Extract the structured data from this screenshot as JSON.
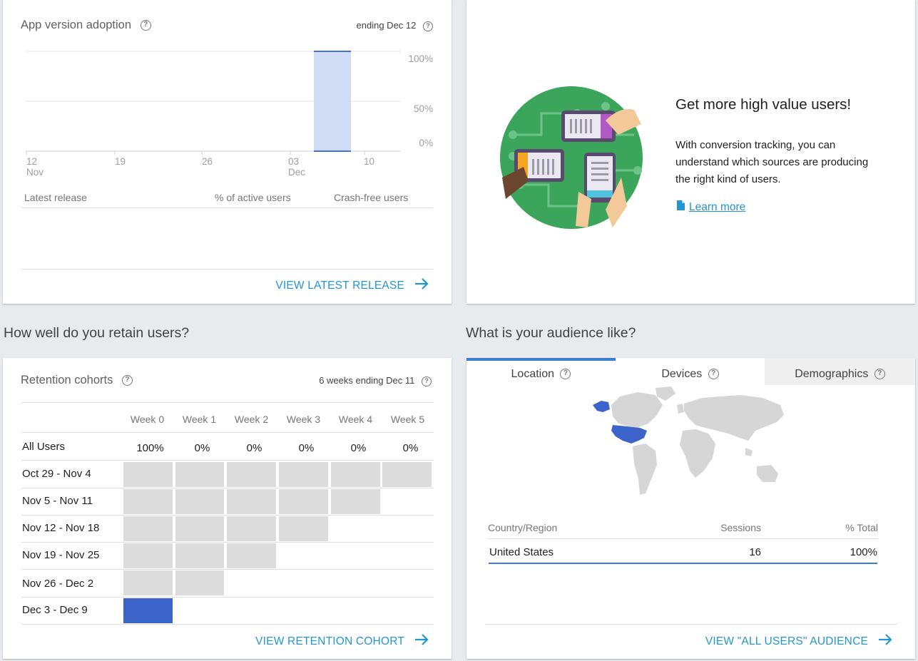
{
  "adoption": {
    "title": "App version adoption",
    "ending": "ending Dec 12",
    "y_ticks": [
      "100%",
      "50%",
      "0%"
    ],
    "x_ticks": [
      {
        "day": "12",
        "month": "Nov"
      },
      {
        "day": "19",
        "month": ""
      },
      {
        "day": "26",
        "month": ""
      },
      {
        "day": "03",
        "month": "Dec"
      },
      {
        "day": "10",
        "month": ""
      }
    ],
    "columns": [
      "Latest release",
      "% of active users",
      "Crash-free users"
    ],
    "view_label": "VIEW LATEST RELEASE"
  },
  "chart_data": {
    "type": "area",
    "x_ticks": [
      "12 Nov",
      "19",
      "26",
      "03 Dec",
      "10"
    ],
    "y_ticks": [
      "0%",
      "50%",
      "100%"
    ],
    "ylim": [
      0,
      100
    ],
    "highlight_range": [
      "Dec 6",
      "Dec 12"
    ],
    "values": [
      100
    ],
    "accent_color": "#4a73d1",
    "fill_color": "#d0dcf3"
  },
  "promo": {
    "title": "Get more high value users!",
    "body_line1": "With conversion tracking, you can",
    "body_line2": "understand which sources are producing",
    "body_line3": "the right kind of users.",
    "link": "Learn more",
    "icon": "document-icon"
  },
  "retention": {
    "section_title": "How well do you retain users?",
    "card_title": "Retention cohorts",
    "range": "6 weeks ending Dec 11",
    "weeks": [
      "Week 0",
      "Week 1",
      "Week 2",
      "Week 3",
      "Week 4",
      "Week 5"
    ],
    "all_users": {
      "label": "All Users",
      "values": [
        "100%",
        "0%",
        "0%",
        "0%",
        "0%",
        "0%"
      ]
    },
    "cohorts": [
      {
        "label": "Oct 29 - Nov 4"
      },
      {
        "label": "Nov 5 - Nov 11"
      },
      {
        "label": "Nov 12 - Nov 18"
      },
      {
        "label": "Nov 19 - Nov 25"
      },
      {
        "label": "Nov 26 - Dec 2"
      },
      {
        "label": "Dec 3 - Dec 9"
      }
    ],
    "view_label": "VIEW RETENTION COHORT",
    "highlight_color": "#3b63c9",
    "empty_color": "#dcdcdc"
  },
  "audience": {
    "section_title": "What is your audience like?",
    "tabs": [
      "Location",
      "Devices",
      "Demographics"
    ],
    "active_tab": "Location",
    "table_headers": [
      "Country/Region",
      "Sessions",
      "% Total"
    ],
    "rows": [
      {
        "country": "United States",
        "sessions": "16",
        "total": "100%"
      }
    ],
    "view_label": "VIEW \"ALL USERS\" AUDIENCE",
    "highlight_color": "#3b63c9"
  }
}
